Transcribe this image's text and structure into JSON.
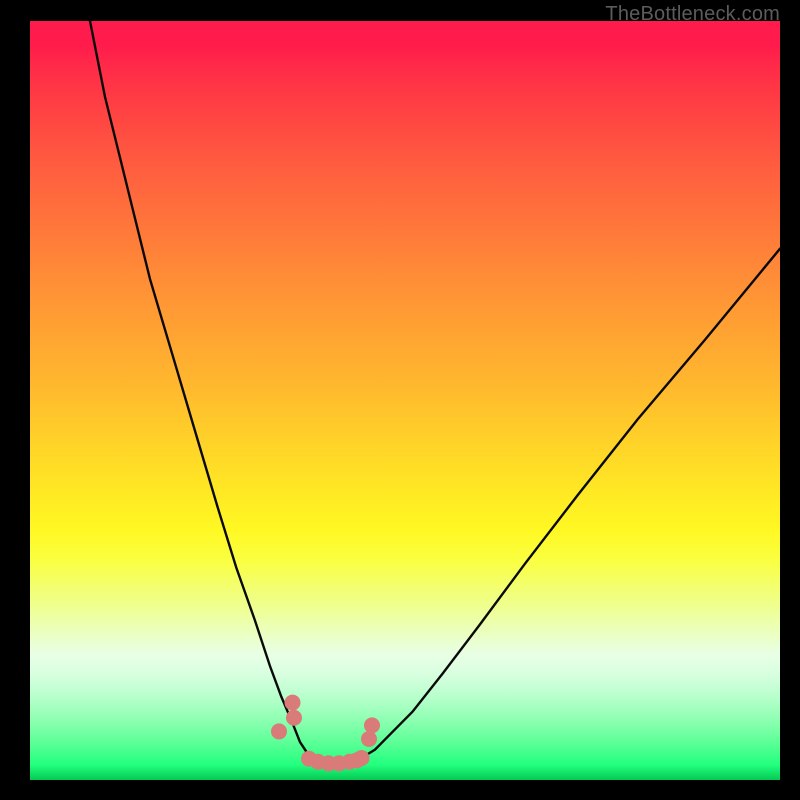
{
  "attribution": "TheBottleneck.com",
  "chart_data": {
    "type": "line",
    "title": "",
    "xlabel": "",
    "ylabel": "",
    "xlim": [
      0,
      100
    ],
    "ylim": [
      0,
      100
    ],
    "grid": false,
    "legend": false,
    "series": [
      {
        "name": "left-curve",
        "x": [
          8,
          10,
          13,
          16,
          19,
          22,
          25,
          27.5,
          30,
          32,
          33.5,
          35,
          36,
          37,
          37.7
        ],
        "values": [
          100,
          90,
          78,
          66,
          56,
          46,
          36,
          28,
          21,
          15,
          11,
          7.5,
          5,
          3.5,
          2.8
        ]
      },
      {
        "name": "right-curve",
        "x": [
          44,
          46,
          48,
          51,
          55,
          60,
          66,
          73,
          81,
          90,
          100
        ],
        "values": [
          2.8,
          4,
          6,
          9,
          14,
          20.5,
          28.5,
          37.5,
          47.5,
          58,
          70
        ]
      },
      {
        "name": "flat-bottom",
        "x": [
          37.7,
          39,
          40.5,
          42,
          43,
          44
        ],
        "values": [
          2.8,
          2.4,
          2.2,
          2.2,
          2.4,
          2.8
        ]
      }
    ],
    "markers": {
      "name": "points",
      "color": "#d97b79",
      "radius_px": 8,
      "x": [
        35.0,
        35.2,
        37.2,
        38.4,
        39.8,
        41.2,
        42.6,
        44.2,
        45.2,
        45.6,
        33.2,
        43.6
      ],
      "values": [
        10.2,
        8.2,
        2.8,
        2.4,
        2.2,
        2.2,
        2.4,
        2.9,
        5.4,
        7.2,
        6.4,
        2.6
      ]
    },
    "background_gradient_note": "vertical red-to-green spectrum, minimum (green) at bottom"
  }
}
